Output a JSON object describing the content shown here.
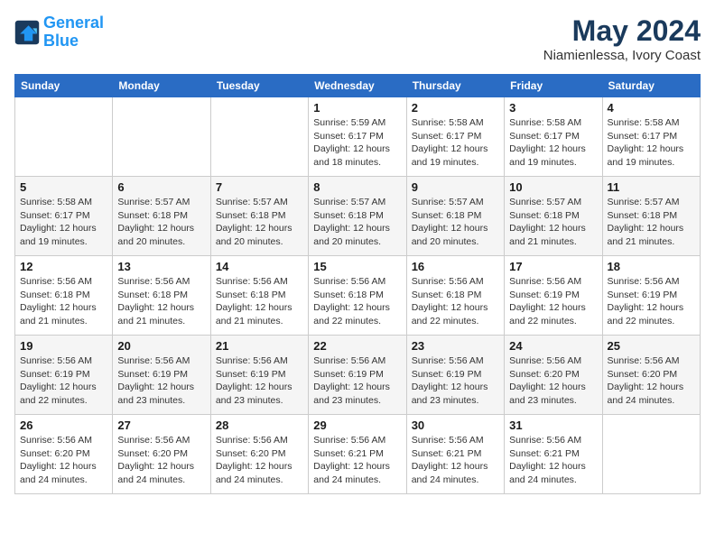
{
  "logo": {
    "line1": "General",
    "line2": "Blue"
  },
  "title": "May 2024",
  "subtitle": "Niamienlessa, Ivory Coast",
  "weekdays": [
    "Sunday",
    "Monday",
    "Tuesday",
    "Wednesday",
    "Thursday",
    "Friday",
    "Saturday"
  ],
  "weeks": [
    [
      {
        "day": "",
        "info": ""
      },
      {
        "day": "",
        "info": ""
      },
      {
        "day": "",
        "info": ""
      },
      {
        "day": "1",
        "info": "Sunrise: 5:59 AM\nSunset: 6:17 PM\nDaylight: 12 hours\nand 18 minutes."
      },
      {
        "day": "2",
        "info": "Sunrise: 5:58 AM\nSunset: 6:17 PM\nDaylight: 12 hours\nand 19 minutes."
      },
      {
        "day": "3",
        "info": "Sunrise: 5:58 AM\nSunset: 6:17 PM\nDaylight: 12 hours\nand 19 minutes."
      },
      {
        "day": "4",
        "info": "Sunrise: 5:58 AM\nSunset: 6:17 PM\nDaylight: 12 hours\nand 19 minutes."
      }
    ],
    [
      {
        "day": "5",
        "info": "Sunrise: 5:58 AM\nSunset: 6:17 PM\nDaylight: 12 hours\nand 19 minutes."
      },
      {
        "day": "6",
        "info": "Sunrise: 5:57 AM\nSunset: 6:18 PM\nDaylight: 12 hours\nand 20 minutes."
      },
      {
        "day": "7",
        "info": "Sunrise: 5:57 AM\nSunset: 6:18 PM\nDaylight: 12 hours\nand 20 minutes."
      },
      {
        "day": "8",
        "info": "Sunrise: 5:57 AM\nSunset: 6:18 PM\nDaylight: 12 hours\nand 20 minutes."
      },
      {
        "day": "9",
        "info": "Sunrise: 5:57 AM\nSunset: 6:18 PM\nDaylight: 12 hours\nand 20 minutes."
      },
      {
        "day": "10",
        "info": "Sunrise: 5:57 AM\nSunset: 6:18 PM\nDaylight: 12 hours\nand 21 minutes."
      },
      {
        "day": "11",
        "info": "Sunrise: 5:57 AM\nSunset: 6:18 PM\nDaylight: 12 hours\nand 21 minutes."
      }
    ],
    [
      {
        "day": "12",
        "info": "Sunrise: 5:56 AM\nSunset: 6:18 PM\nDaylight: 12 hours\nand 21 minutes."
      },
      {
        "day": "13",
        "info": "Sunrise: 5:56 AM\nSunset: 6:18 PM\nDaylight: 12 hours\nand 21 minutes."
      },
      {
        "day": "14",
        "info": "Sunrise: 5:56 AM\nSunset: 6:18 PM\nDaylight: 12 hours\nand 21 minutes."
      },
      {
        "day": "15",
        "info": "Sunrise: 5:56 AM\nSunset: 6:18 PM\nDaylight: 12 hours\nand 22 minutes."
      },
      {
        "day": "16",
        "info": "Sunrise: 5:56 AM\nSunset: 6:18 PM\nDaylight: 12 hours\nand 22 minutes."
      },
      {
        "day": "17",
        "info": "Sunrise: 5:56 AM\nSunset: 6:19 PM\nDaylight: 12 hours\nand 22 minutes."
      },
      {
        "day": "18",
        "info": "Sunrise: 5:56 AM\nSunset: 6:19 PM\nDaylight: 12 hours\nand 22 minutes."
      }
    ],
    [
      {
        "day": "19",
        "info": "Sunrise: 5:56 AM\nSunset: 6:19 PM\nDaylight: 12 hours\nand 22 minutes."
      },
      {
        "day": "20",
        "info": "Sunrise: 5:56 AM\nSunset: 6:19 PM\nDaylight: 12 hours\nand 23 minutes."
      },
      {
        "day": "21",
        "info": "Sunrise: 5:56 AM\nSunset: 6:19 PM\nDaylight: 12 hours\nand 23 minutes."
      },
      {
        "day": "22",
        "info": "Sunrise: 5:56 AM\nSunset: 6:19 PM\nDaylight: 12 hours\nand 23 minutes."
      },
      {
        "day": "23",
        "info": "Sunrise: 5:56 AM\nSunset: 6:19 PM\nDaylight: 12 hours\nand 23 minutes."
      },
      {
        "day": "24",
        "info": "Sunrise: 5:56 AM\nSunset: 6:20 PM\nDaylight: 12 hours\nand 23 minutes."
      },
      {
        "day": "25",
        "info": "Sunrise: 5:56 AM\nSunset: 6:20 PM\nDaylight: 12 hours\nand 24 minutes."
      }
    ],
    [
      {
        "day": "26",
        "info": "Sunrise: 5:56 AM\nSunset: 6:20 PM\nDaylight: 12 hours\nand 24 minutes."
      },
      {
        "day": "27",
        "info": "Sunrise: 5:56 AM\nSunset: 6:20 PM\nDaylight: 12 hours\nand 24 minutes."
      },
      {
        "day": "28",
        "info": "Sunrise: 5:56 AM\nSunset: 6:20 PM\nDaylight: 12 hours\nand 24 minutes."
      },
      {
        "day": "29",
        "info": "Sunrise: 5:56 AM\nSunset: 6:21 PM\nDaylight: 12 hours\nand 24 minutes."
      },
      {
        "day": "30",
        "info": "Sunrise: 5:56 AM\nSunset: 6:21 PM\nDaylight: 12 hours\nand 24 minutes."
      },
      {
        "day": "31",
        "info": "Sunrise: 5:56 AM\nSunset: 6:21 PM\nDaylight: 12 hours\nand 24 minutes."
      },
      {
        "day": "",
        "info": ""
      }
    ]
  ]
}
